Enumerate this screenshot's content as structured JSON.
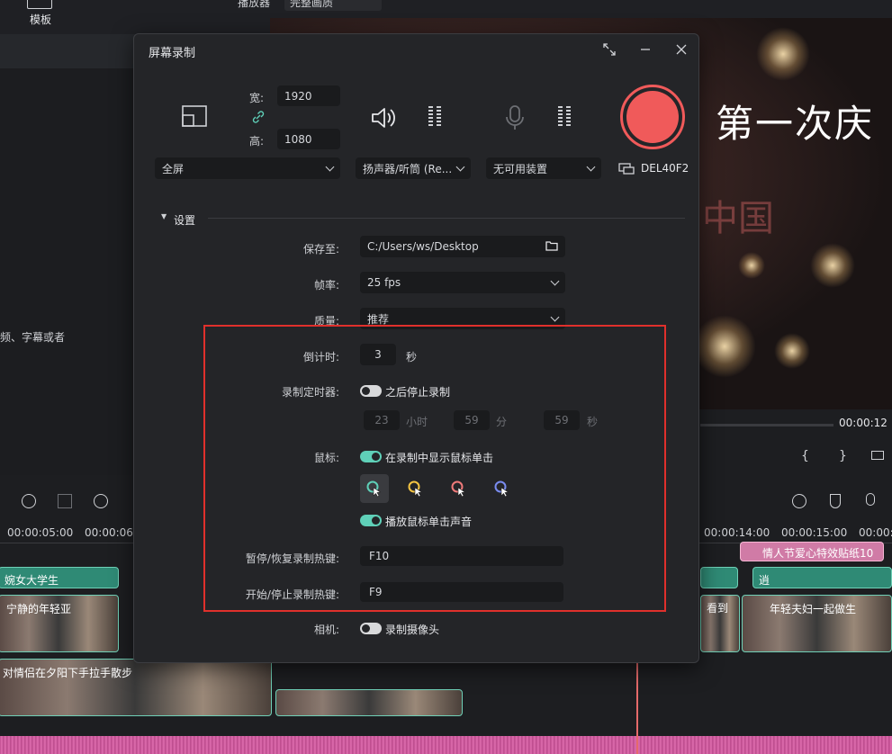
{
  "background_app": {
    "left_tab_label": "模板",
    "player_label": "播放器",
    "quality_label": "完整画质",
    "left_hint_text": "频、字幕或者",
    "preview_caption": "第一次庆",
    "preview_watermark": "中国",
    "timecode": "00:00:12",
    "ruler_labels": [
      "00:00:05:00",
      "00:00:06:",
      "00:00:14:00",
      "00:00:15:00",
      "00:00:"
    ],
    "tracks": {
      "text1": "婉女大学生",
      "text2": "宁静的年轻亚",
      "text3": "对情侣在夕阳下手拉手散步",
      "text4": "看到",
      "text5": "年轻夫妇一起做生",
      "text6": "情人节爱心特效贴纸10",
      "text7": "逍"
    }
  },
  "dialog": {
    "title": "屏幕录制",
    "width_label": "宽:",
    "width_value": "1920",
    "height_label": "高:",
    "height_value": "1080",
    "area_select": "全屏",
    "speaker_select": "扬声器/听筒 (Re...",
    "mic_select": "无可用装置",
    "monitor_label": "DEL40F2",
    "settings_header": "设置",
    "save_to_label": "保存至:",
    "save_to_value": "C:/Users/ws/Desktop",
    "fps_label": "帧率:",
    "fps_value": "25 fps",
    "quality_label": "质量:",
    "quality_value": "推荐",
    "countdown_label": "倒计时:",
    "countdown_value": "3",
    "countdown_unit": "秒",
    "timer_label": "录制定时器:",
    "timer_toggle_text": "之后停止录制",
    "timer_hours": "23",
    "timer_hours_unit": "小时",
    "timer_minutes": "59",
    "timer_minutes_unit": "分",
    "timer_seconds": "59",
    "timer_seconds_unit": "秒",
    "mouse_label": "鼠标:",
    "mouse_show_clicks": "在录制中显示鼠标单击",
    "mouse_click_sound": "播放鼠标单击声音",
    "pause_hotkey_label": "暂停/恢复录制热键:",
    "pause_hotkey_value": "F10",
    "start_hotkey_label": "开始/停止录制热键:",
    "start_hotkey_value": "F9",
    "camera_label": "相机:",
    "camera_toggle_text": "录制摄像头"
  },
  "colors": {
    "accent": "#5fd0b8",
    "record": "#f05a5a",
    "highlight": "#e0302c"
  },
  "icons": {
    "cursor_colors": [
      "#5fd0b8",
      "#f5c542",
      "#f07a7a",
      "#7a8cf0"
    ]
  },
  "toggles": {
    "timer": false,
    "show_clicks": true,
    "click_sound": true,
    "camera": false
  }
}
